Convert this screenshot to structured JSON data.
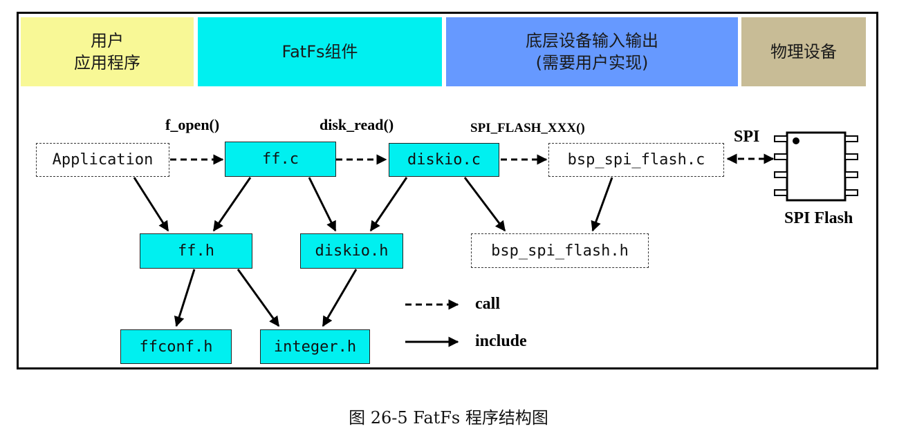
{
  "headers": {
    "app": {
      "text": "用户\n应用程序",
      "color": "#f8f896"
    },
    "fatfs": {
      "text": "FatFs组件",
      "color": "#00f0f0"
    },
    "lowlevel": {
      "text": "底层设备输入输出\n(需要用户实现)",
      "color": "#6699ff"
    },
    "device": {
      "text": "物理设备",
      "color": "#c8bc96"
    }
  },
  "boxes": {
    "application": "Application",
    "ff_c": "ff.c",
    "diskio_c": "diskio.c",
    "bsp_c": "bsp_spi_flash.c",
    "ff_h": "ff.h",
    "diskio_h": "diskio.h",
    "bsp_h": "bsp_spi_flash.h",
    "ffconf_h": "ffconf.h",
    "integer_h": "integer.h"
  },
  "labels": {
    "f_open": "f_open()",
    "disk_read": "disk_read()",
    "spi_flash_xxx": "SPI_FLASH_XXX()",
    "spi": "SPI",
    "spi_flash": "SPI Flash"
  },
  "legend": {
    "call": "call",
    "include": "include"
  },
  "caption": "图 26-5 FatFs 程序结构图"
}
